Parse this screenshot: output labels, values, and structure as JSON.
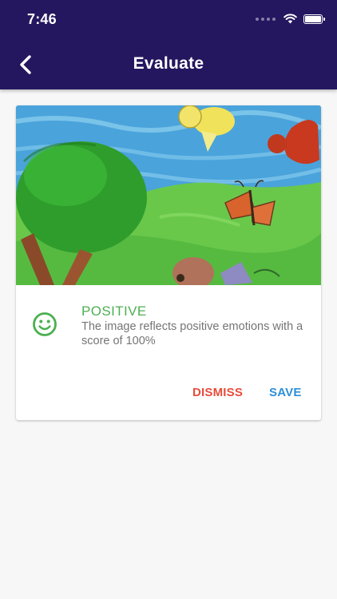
{
  "status_bar": {
    "time": "7:46"
  },
  "app_bar": {
    "title": "Evaluate"
  },
  "result": {
    "sentiment": "POSITIVE",
    "description": "The image reflects positive emotions with a score of 100%"
  },
  "actions": {
    "dismiss": "DISMISS",
    "save": "SAVE"
  },
  "colors": {
    "app_bar": "#24175f",
    "positive": "#4caf50",
    "dismiss": "#e74c3c",
    "save": "#2e8fd7"
  },
  "icons": {
    "back": "chevron-left-icon",
    "sentiment": "smiley-icon",
    "wifi": "wifi-icon",
    "battery": "battery-icon"
  }
}
